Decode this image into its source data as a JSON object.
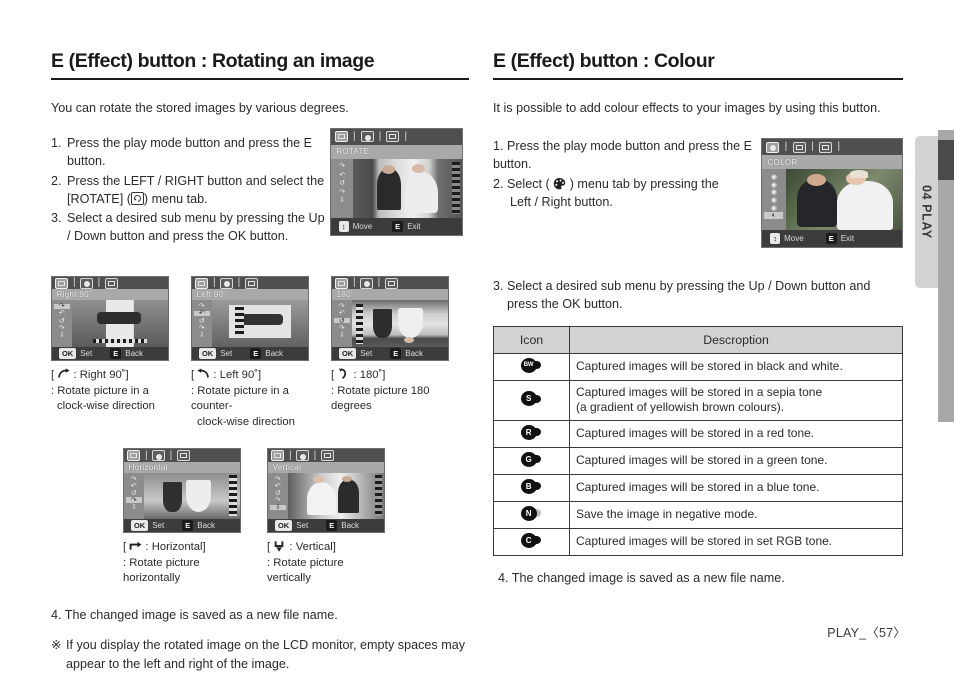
{
  "left": {
    "heading": "E (Effect) button : Rotating an image",
    "intro": "You can rotate the stored images by various degrees.",
    "steps": [
      {
        "num": "1.",
        "text_before": "Press the play mode button and press the E button.",
        "text_after": ""
      },
      {
        "num": "2.",
        "text_before": "Press the LEFT / RIGHT button and select the [ROTATE] (",
        "text_after": ") menu tab."
      },
      {
        "num": "3.",
        "text_before": "Select a desired sub menu by pressing the Up / Down button and press the OK button.",
        "text_after": ""
      }
    ],
    "final_step": "4. The changed image is saved as a new file name.",
    "note_mark": "※",
    "note": "If you display the rotated image on the LCD monitor, empty spaces may appear to the left and right of the image.",
    "lcd_main": {
      "title": "ROTATE",
      "tabs": [
        "rotate-tab",
        "color-tab",
        "resize-tab"
      ],
      "selected_tab": 0,
      "side_items": [
        "right90",
        "left90",
        "180",
        "horizontal",
        "vertical"
      ],
      "selected_side": 0,
      "footer_move": "Move",
      "footer_key": "E",
      "footer_exit": "Exit"
    },
    "thumbs": [
      {
        "lcd_title": "Right 90˚",
        "selected_side": 0,
        "footer_key_left": "OK",
        "footer_set": "Set",
        "footer_key_right": "E",
        "footer_back": "Back",
        "cap_head_pre": "[",
        "cap_head_post": ": Right 90˚]",
        "cap_line1": ": Rotate picture in a",
        "cap_line2": "clock-wise direction"
      },
      {
        "lcd_title": "Left 90˚",
        "selected_side": 1,
        "footer_key_left": "OK",
        "footer_set": "Set",
        "footer_key_right": "E",
        "footer_back": "Back",
        "cap_head_pre": "[",
        "cap_head_post": ":  Left 90˚]",
        "cap_line1": ": Rotate picture in a counter-",
        "cap_line2": "clock-wise direction"
      },
      {
        "lcd_title": "180˚",
        "selected_side": 2,
        "footer_key_left": "OK",
        "footer_set": "Set",
        "footer_key_right": "E",
        "footer_back": "Back",
        "cap_head_pre": "[",
        "cap_head_post": ":  180˚]",
        "cap_line1": ": Rotate picture 180 degrees",
        "cap_line2": ""
      }
    ],
    "thumbs2": [
      {
        "lcd_title": "Horizontal",
        "selected_side": 3,
        "footer_key_left": "OK",
        "footer_set": "Set",
        "footer_key_right": "E",
        "footer_back": "Back",
        "cap_head_pre": "[",
        "cap_head_post": ":  Horizontal]",
        "cap_line1": ": Rotate picture horizontally",
        "cap_line2": ""
      },
      {
        "lcd_title": "Vertical",
        "selected_side": 4,
        "footer_key_left": "OK",
        "footer_set": "Set",
        "footer_key_right": "E",
        "footer_back": "Back",
        "cap_head_pre": "[",
        "cap_head_post": ":  Vertical]",
        "cap_line1": ": Rotate picture vertically",
        "cap_line2": ""
      }
    ]
  },
  "right": {
    "heading": "E (Effect) button : Colour",
    "intro": "It is possible to add colour effects to your images by using this button.",
    "step1": "1. Press the play mode button and press the E button.",
    "step2_pre": "2. Select (",
    "step2_post": ") menu tab by pressing the",
    "step2_line2": "Left / Right button.",
    "step3_line1": "3. Select a desired sub menu by pressing the Up / Down button and",
    "step3_line2": "press the OK button.",
    "final_step": "4. The changed image is saved as a new file name.",
    "lcd": {
      "title": "COLOR",
      "selected_tab": 0,
      "selected_side": 5,
      "footer_move": "Move",
      "footer_key": "E",
      "footer_exit": "Exit"
    },
    "table": {
      "headers": [
        "Icon",
        "Descroption"
      ],
      "rows": [
        {
          "icon": "BW",
          "icon_style": "normal",
          "desc": "Captured images will be stored in black and white."
        },
        {
          "icon": "S",
          "icon_style": "normal",
          "desc": "Captured images will be stored in a sepia tone\n(a gradient of yellowish brown colours)."
        },
        {
          "icon": "R",
          "icon_style": "normal",
          "desc": "Captured images will be stored in a red tone."
        },
        {
          "icon": "G",
          "icon_style": "normal",
          "desc": "Captured images will be stored in a green tone."
        },
        {
          "icon": "B",
          "icon_style": "normal",
          "desc": "Captured images will be stored in a blue tone."
        },
        {
          "icon": "N",
          "icon_style": "negative",
          "desc": "Save the image in negative mode."
        },
        {
          "icon": "C",
          "icon_style": "normal",
          "desc": "Captured images will be stored in set RGB tone."
        }
      ]
    }
  },
  "side_tab": {
    "label": "04 PLAY"
  },
  "footer": {
    "text": "PLAY_",
    "open": "〈",
    "page": "57",
    "close": "〉"
  },
  "colors": {
    "ink": "#231f20",
    "lcd_bg": "#8e8e8e",
    "lcd_tabbar": "#4f4f4f",
    "lcd_titlebar": "#a9a9a9",
    "lcd_footer": "#3c3c3c",
    "table_header": "#d2d2d2",
    "side_tab": "#d3d3d3",
    "side_bar": "#a8a8a8"
  }
}
